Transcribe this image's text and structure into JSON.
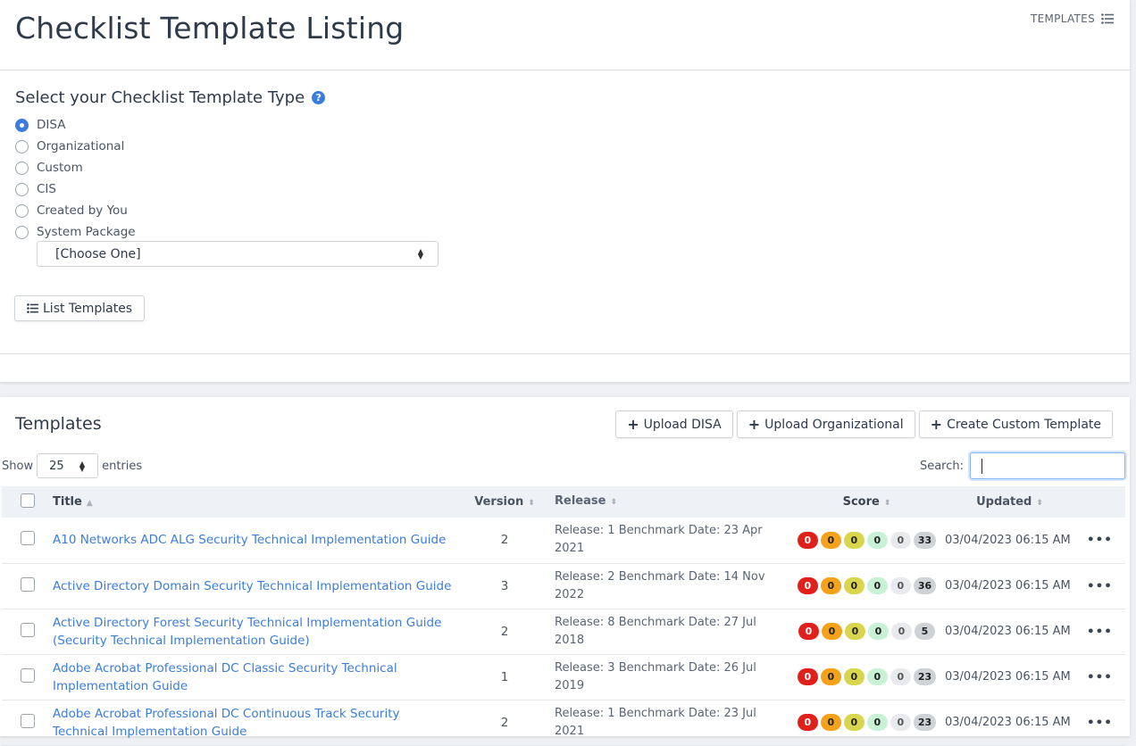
{
  "header": {
    "title": "Checklist Template Listing",
    "templates_link": "TEMPLATES"
  },
  "type_selector": {
    "heading": "Select your Checklist Template Type",
    "options": [
      {
        "label": "DISA",
        "checked": true
      },
      {
        "label": "Organizational",
        "checked": false
      },
      {
        "label": "Custom",
        "checked": false
      },
      {
        "label": "CIS",
        "checked": false
      },
      {
        "label": "Created by You",
        "checked": false
      },
      {
        "label": "System Package",
        "checked": false
      }
    ],
    "package_select_value": "[Choose One]",
    "list_button": "List Templates"
  },
  "templates": {
    "heading": "Templates",
    "buttons": {
      "upload_disa": "Upload DISA",
      "upload_org": "Upload Organizational",
      "create_custom": "Create Custom Template"
    },
    "show_label": "Show",
    "entries_value": "25",
    "entries_label": "entries",
    "search_label": "Search:",
    "columns": {
      "title": "Title",
      "version": "Version",
      "release": "Release",
      "score": "Score",
      "updated": "Updated"
    },
    "rows": [
      {
        "title": "A10 Networks ADC ALG Security Technical Implementation Guide",
        "version": "2",
        "release": "Release: 1 Benchmark Date: 23 Apr 2021",
        "score": [
          "0",
          "0",
          "0",
          "0",
          "0",
          "33"
        ],
        "updated": "03/04/2023 06:15 AM"
      },
      {
        "title": "Active Directory Domain Security Technical Implementation Guide",
        "version": "3",
        "release": "Release: 2 Benchmark Date: 14 Nov 2022",
        "score": [
          "0",
          "0",
          "0",
          "0",
          "0",
          "36"
        ],
        "updated": "03/04/2023 06:15 AM"
      },
      {
        "title": "Active Directory Forest Security Technical Implementation Guide (Security Technical Implementation Guide)",
        "version": "2",
        "release": "Release: 8 Benchmark Date: 27 Jul 2018",
        "score": [
          "0",
          "0",
          "0",
          "0",
          "0",
          "5"
        ],
        "updated": "03/04/2023 06:15 AM"
      },
      {
        "title": "Adobe Acrobat Professional DC Classic Security Technical Implementation Guide",
        "version": "1",
        "release": "Release: 3 Benchmark Date: 26 Jul 2019",
        "score": [
          "0",
          "0",
          "0",
          "0",
          "0",
          "23"
        ],
        "updated": "03/04/2023 06:15 AM"
      },
      {
        "title": "Adobe Acrobat Professional DC Continuous Track Security Technical Implementation Guide",
        "version": "2",
        "release": "Release: 1 Benchmark Date: 23 Jul 2021",
        "score": [
          "0",
          "0",
          "0",
          "0",
          "0",
          "23"
        ],
        "updated": "03/04/2023 06:15 AM"
      }
    ]
  },
  "colors": {
    "accent": "#3b7ddd",
    "score_red": "#e0201b",
    "score_orange": "#f3a21a",
    "score_yellow": "#d9d64e",
    "score_green": "#c9f1d6"
  }
}
